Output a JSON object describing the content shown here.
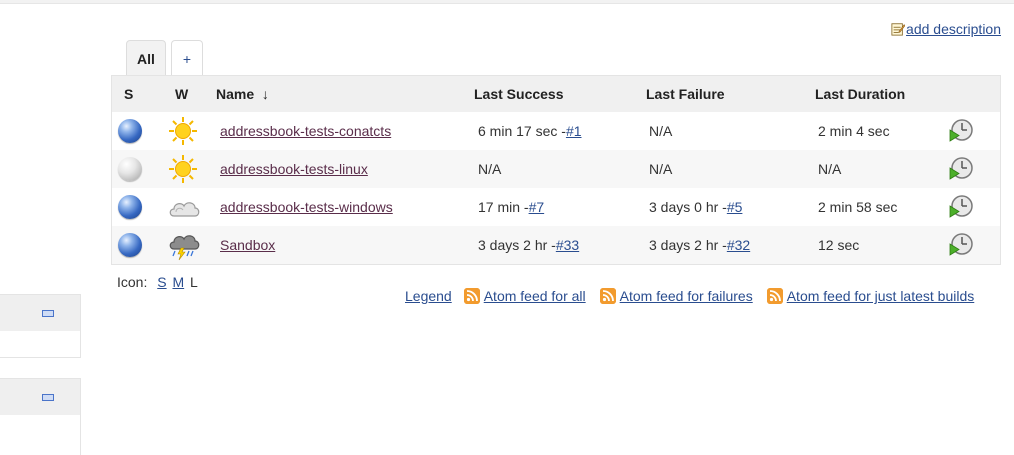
{
  "add_description": "add description",
  "tabs": [
    {
      "label": "All"
    },
    {
      "label": "+"
    }
  ],
  "table": {
    "headers": {
      "s": "S",
      "w": "W",
      "name": "Name",
      "sort_indicator": "↓",
      "last_success": "Last Success",
      "last_failure": "Last Failure",
      "last_duration": "Last Duration"
    },
    "rows": [
      {
        "status": "blue",
        "weather": "sunny",
        "name": "addressbook-tests-conatcts",
        "succ_text": "6 min 17 sec - ",
        "succ_build": "#1",
        "fail_text": "N/A",
        "fail_build": "",
        "duration": "2 min 4 sec"
      },
      {
        "status": "grey",
        "weather": "sunny",
        "name": "addressbook-tests-linux",
        "succ_text": "N/A",
        "succ_build": "",
        "fail_text": "N/A",
        "fail_build": "",
        "duration": "N/A"
      },
      {
        "status": "blue",
        "weather": "cloudy",
        "name": "addressbook-tests-windows",
        "succ_text": "17 min - ",
        "succ_build": "#7",
        "fail_text": "3 days 0 hr - ",
        "fail_build": "#5",
        "duration": "2 min 58 sec"
      },
      {
        "status": "blue",
        "weather": "storm",
        "name": "Sandbox",
        "succ_text": "3 days 2 hr - ",
        "succ_build": "#33",
        "fail_text": "3 days 2 hr - ",
        "fail_build": "#32",
        "duration": "12 sec"
      }
    ]
  },
  "icon_size": {
    "label": "Icon:",
    "small": "S",
    "medium": "M",
    "large": "L"
  },
  "feeds": {
    "legend": "Legend",
    "all": "Atom feed for all",
    "failures": "Atom feed for failures",
    "latest": "Atom feed for just latest builds"
  },
  "colors": {
    "link": "#2a4d8f",
    "job_link": "#5a2d4a",
    "header_bg": "#f0f0f0",
    "rss": "#f29b2e"
  }
}
